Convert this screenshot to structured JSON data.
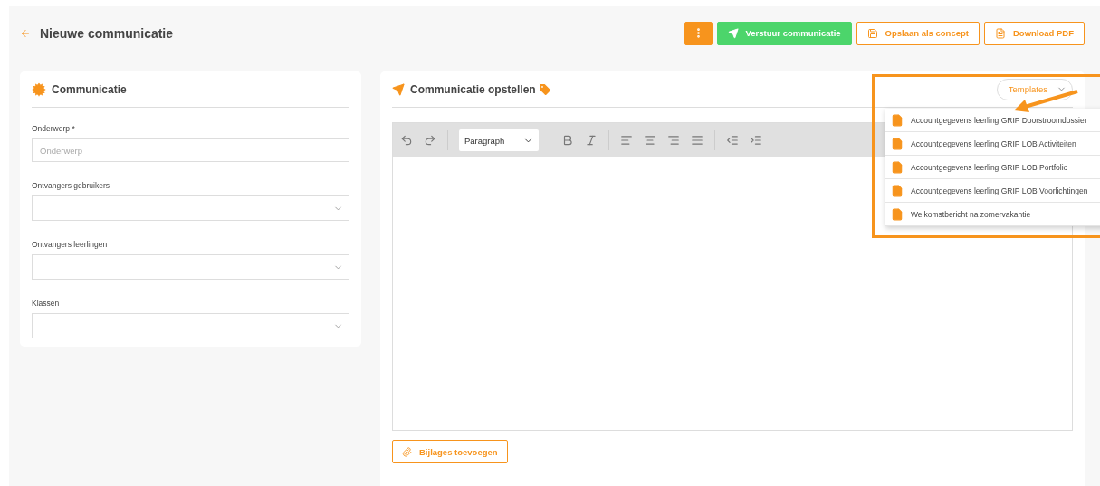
{
  "header": {
    "title": "Nieuwe communicatie"
  },
  "actions": [
    {
      "kind": "menu"
    },
    {
      "kind": "send",
      "label": "Verstuur communicatie"
    },
    {
      "kind": "save",
      "label": "Opslaan als concept"
    },
    {
      "kind": "pdf",
      "label": "Download PDF"
    }
  ],
  "details_card": {
    "title": "Communicatie",
    "fields": [
      {
        "kind": "text",
        "label": "Onderwerp *",
        "placeholder": "Onderwerp"
      },
      {
        "kind": "select",
        "label": "Ontvangers gebruikers"
      },
      {
        "kind": "select",
        "label": "Ontvangers leerlingen"
      },
      {
        "kind": "select",
        "label": "Klassen"
      }
    ]
  },
  "compose_card": {
    "title": "Communicatie opstellen",
    "templates_button": "Templates",
    "block_format": "Paragraph",
    "templates": [
      {
        "label": "Accountgegevens leerling GRIP Doorstroomdossier"
      },
      {
        "label": "Accountgegevens leerling GRIP LOB Activiteiten"
      },
      {
        "label": "Accountgegevens leerling GRIP LOB Portfolio"
      },
      {
        "label": "Accountgegevens leerling GRIP LOB Voorlichtingen"
      },
      {
        "label": "Welkomstbericht na zomervakantie"
      }
    ],
    "attach_button": "Bijlages toevoegen"
  }
}
